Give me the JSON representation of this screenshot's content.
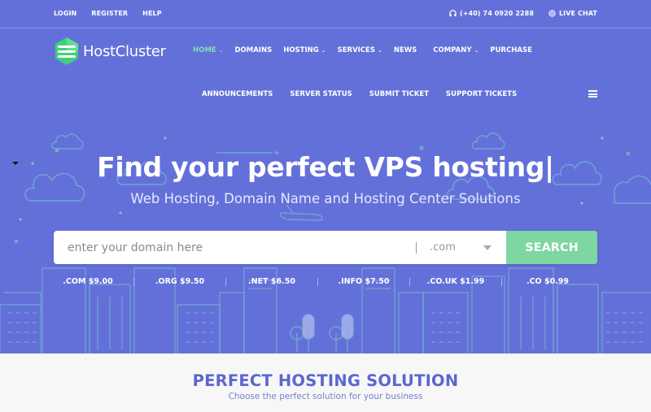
{
  "colors": {
    "hero_bg": "#6470d9",
    "accent_green": "#7ed6a0",
    "active_nav": "#7fe0b4",
    "section_title": "#5b67cf"
  },
  "topbar": {
    "links": [
      "LOGIN",
      "REGISTER",
      "HELP"
    ],
    "phone_icon": "headset-icon",
    "phone": "(+40) 74 0920 2288",
    "chat_icon": "at-icon",
    "chat": "LIVE CHAT"
  },
  "brand": {
    "name": "HostCluster",
    "icon": "server-stack-logo"
  },
  "nav": {
    "items": [
      {
        "label": "HOME",
        "dropdown": true,
        "active": true
      },
      {
        "label": "DOMAINS",
        "dropdown": false
      },
      {
        "label": "HOSTING",
        "dropdown": true
      },
      {
        "label": "SERVICES",
        "dropdown": true
      },
      {
        "label": "NEWS",
        "dropdown": false
      },
      {
        "label": "COMPANY",
        "dropdown": true
      },
      {
        "label": "PURCHASE",
        "dropdown": false
      }
    ],
    "sub_items": [
      "ANNOUNCEMENTS",
      "SERVER STATUS",
      "SUBMIT TICKET",
      "SUPPORT TICKETS"
    ],
    "menu_icon": "hamburger-icon"
  },
  "hero": {
    "title": "Find your perfect VPS hosting|",
    "subtitle": "Web Hosting, Domain Name and Hosting Center Solutions"
  },
  "search": {
    "placeholder": "enter your domain here",
    "value": "",
    "tld_selected": ".com",
    "button": "SEARCH"
  },
  "prices": [
    {
      "tld": ".COM",
      "price": "$9.00"
    },
    {
      "tld": ".ORG",
      "price": "$9.50"
    },
    {
      "tld": ".NET",
      "price": "$6.50"
    },
    {
      "tld": ".INFO",
      "price": "$7.50"
    },
    {
      "tld": ".CO.UK",
      "price": "$1.99"
    },
    {
      "tld": ".CO",
      "price": "$0.99"
    }
  ],
  "section": {
    "title": "PERFECT HOSTING SOLUTION",
    "subtitle": "Choose the perfect solution for your business"
  }
}
